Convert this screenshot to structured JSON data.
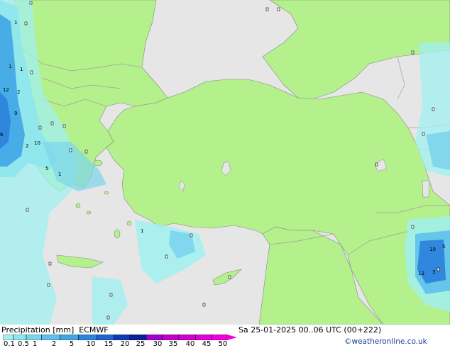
{
  "title_product": "Precipitation [mm]",
  "model": "ECMWF",
  "datetime": "Sa 25-01-2025 00..06 UTC (00+222)",
  "credit": "©weatheronline.co.uk",
  "legend": {
    "levels": [
      "0.1",
      "0.5",
      "1",
      "2",
      "5",
      "10",
      "15",
      "20",
      "25",
      "30",
      "35",
      "40",
      "45",
      "50"
    ],
    "colors": [
      "#a0f0f0",
      "#8ee6ee",
      "#7cd4ec",
      "#5ec0ec",
      "#40a6e6",
      "#2d84dc",
      "#1f64d0",
      "#0f3ab4",
      "#08209a",
      "#a000c8",
      "#c000c8",
      "#d000d0",
      "#e000d8",
      "#f000e0"
    ]
  },
  "map_colors": {
    "land": "#b4f08c",
    "sea": "#e6e6e6",
    "border": "#a0a0a0",
    "coast": "#888888"
  },
  "precip_labels": [
    "1",
    "1",
    "1",
    "1",
    "1",
    "2",
    "2",
    "3",
    "5",
    "5",
    "6",
    "9",
    "10",
    "10",
    "12",
    "13"
  ]
}
